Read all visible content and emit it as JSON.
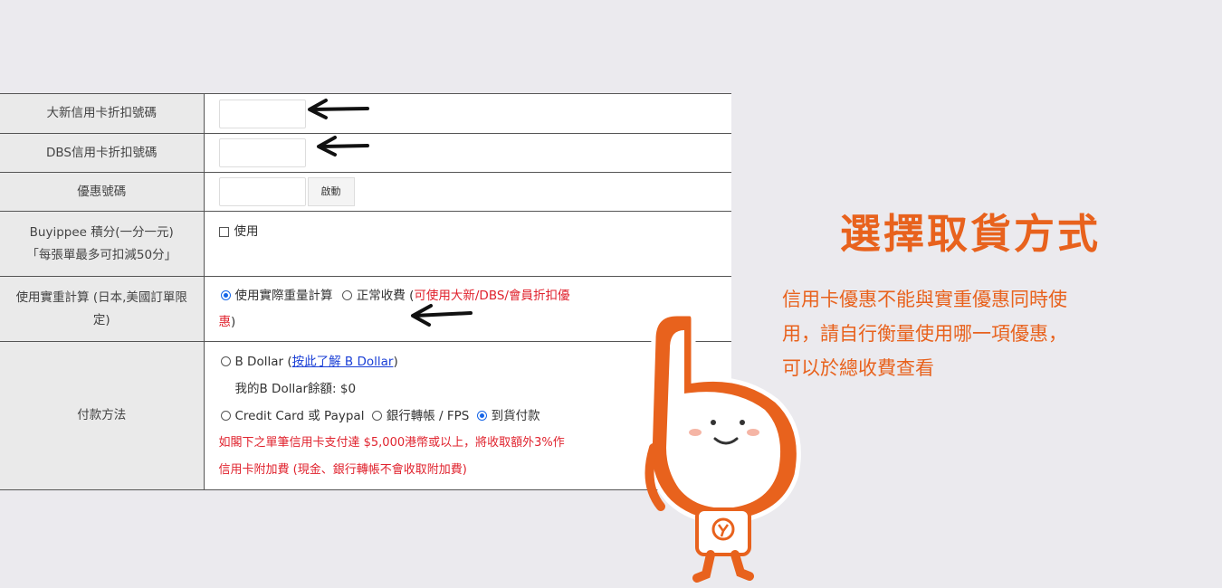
{
  "rows": {
    "dah_sing": {
      "label": "大新信用卡折扣號碼",
      "value": "",
      "placeholder": ""
    },
    "dbs": {
      "label": "DBS信用卡折扣號碼",
      "value": "",
      "placeholder": ""
    },
    "promo": {
      "label": "優惠號碼",
      "value": "",
      "placeholder": "",
      "button": "啟動"
    },
    "points": {
      "label_line1": "Buyippee 積分(一分一元)",
      "label_line2": "「每張單最多可扣減50分」",
      "checkbox_label": "使用"
    },
    "weight": {
      "label_line1": "使用實重計算 (日本,美國訂單限",
      "label_line2": "定)",
      "option_actual": "使用實際重量計算",
      "option_normal": "正常收費",
      "note_open": "(",
      "note_red": "可使用大新/DBS/會員折扣優",
      "note_red2": "惠",
      "note_close": ")",
      "selected": "使用實際重量計算"
    },
    "payment": {
      "label": "付款方法",
      "bdollar_option": "B Dollar",
      "bdollar_open": "(",
      "bdollar_link": "按此了解 B Dollar",
      "bdollar_close": ")",
      "balance": "我的B Dollar餘額: $0",
      "option_credit": "Credit Card 或 Paypal",
      "option_bank": "銀行轉帳 / FPS",
      "option_cod": "到貨付款",
      "selected": "到貨付款",
      "warning_line1": "如閣下之單筆信用卡支付達 $5,000港幣或以上，將收取額外3%作",
      "warning_line2": "信用卡附加費 (現金、銀行轉帳不會收取附加費)"
    }
  },
  "promo_panel": {
    "title": "選擇取貨方式",
    "description_lines": [
      "信用卡優惠不能與實重優惠同時使",
      "用，請自行衡量使用哪一項優惠，",
      "可以於總收費查看"
    ]
  },
  "colors": {
    "accent": "#e8621d",
    "warning_red": "#e0232e",
    "link_blue": "#1a3fd6",
    "label_bg": "#eaeaea",
    "page_bg": "#ebeaee"
  },
  "icons": [
    "arrow-left-icon",
    "radio-icon",
    "checkbox-icon",
    "mascot-illustration"
  ]
}
